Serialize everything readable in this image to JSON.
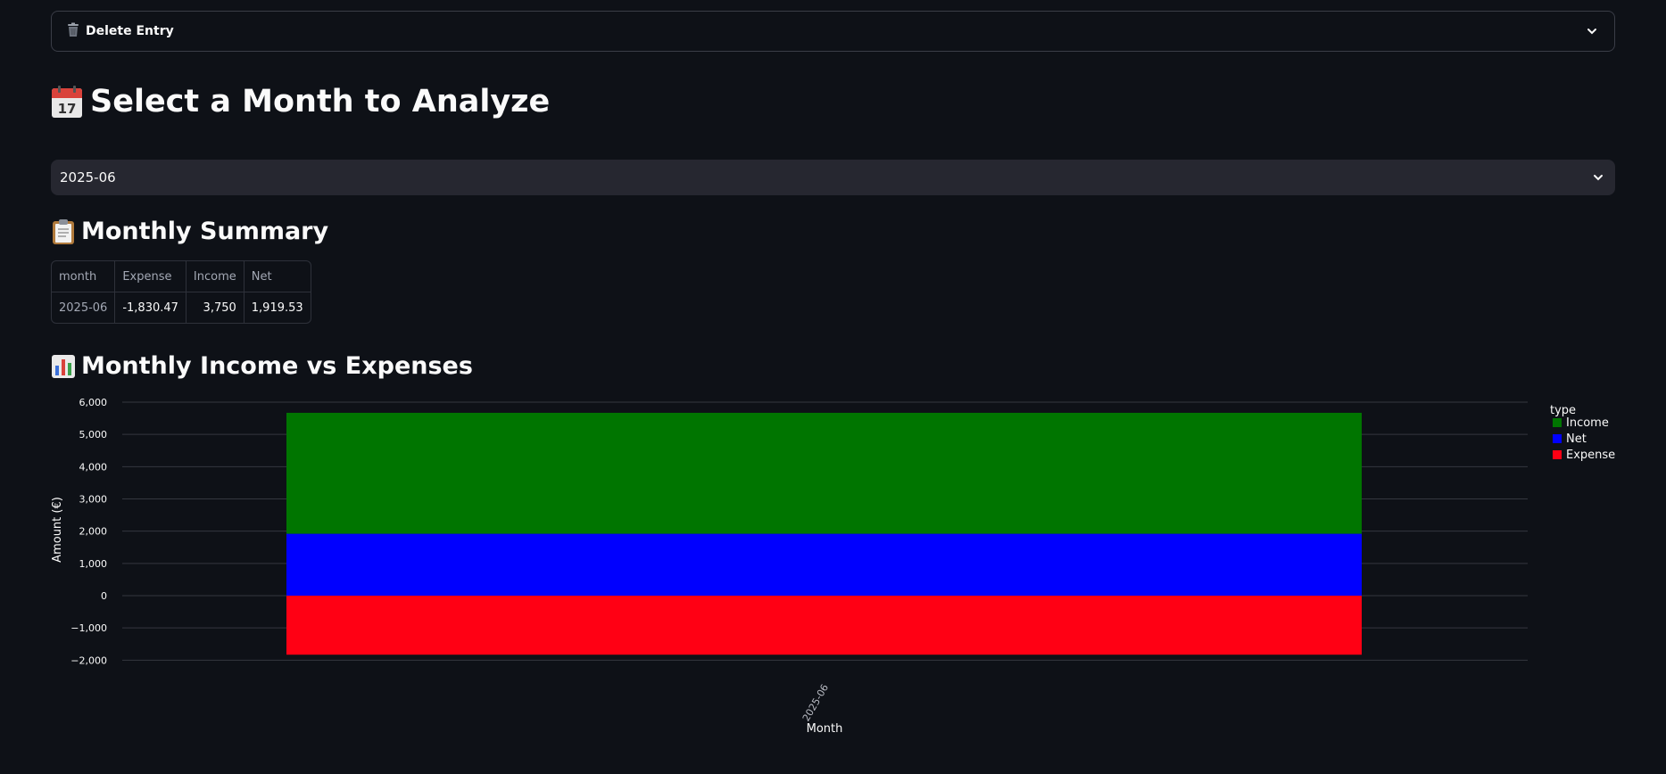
{
  "expander": {
    "label": "Delete Entry",
    "icon": "trash-icon"
  },
  "page": {
    "title": "Select a Month to Analyze",
    "title_icon": "calendar-icon"
  },
  "month_select": {
    "value": "2025-06"
  },
  "summary": {
    "heading": "Monthly Summary",
    "heading_icon": "clipboard-icon",
    "columns": [
      "month",
      "Expense",
      "Income",
      "Net"
    ],
    "rows": [
      [
        "2025-06",
        "-1,830.47",
        "3,750",
        "1,919.53"
      ]
    ]
  },
  "chart_section": {
    "heading": "Monthly Income vs Expenses",
    "heading_icon": "bar-chart-icon"
  },
  "chart_data": {
    "type": "bar",
    "stacked": true,
    "categories": [
      "2025-06"
    ],
    "series": [
      {
        "name": "Income",
        "values": [
          3750
        ],
        "color": "#007500"
      },
      {
        "name": "Net",
        "values": [
          1919.53
        ],
        "color": "#0000ff"
      },
      {
        "name": "Expense",
        "values": [
          -1830.47
        ],
        "color": "#ff0014"
      }
    ],
    "xlabel": "Month",
    "ylabel": "Amount (€)",
    "ylim": [
      -2000,
      6000
    ],
    "yticks": [
      6000,
      5000,
      4000,
      3000,
      2000,
      1000,
      0,
      -1000,
      -2000
    ],
    "ytick_labels": [
      "6,000",
      "5,000",
      "4,000",
      "3,000",
      "2,000",
      "1,000",
      "0",
      "−1,000",
      "−2,000"
    ],
    "legend_title": "type",
    "legend_position": "right",
    "grid": true
  }
}
